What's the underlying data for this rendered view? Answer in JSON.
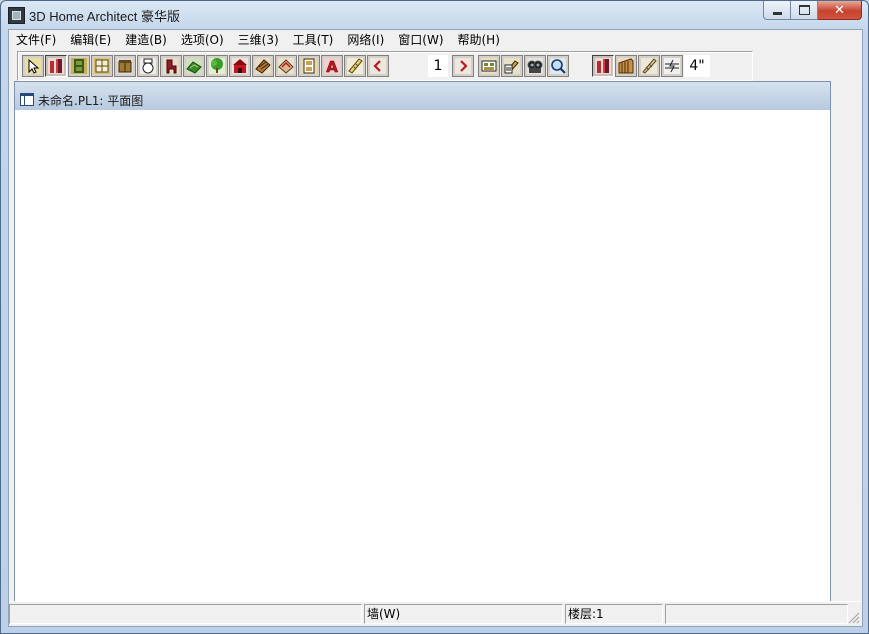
{
  "window": {
    "title": "3D Home Architect 豪华版"
  },
  "menu": [
    {
      "label": "文件(F)"
    },
    {
      "label": "编辑(E)"
    },
    {
      "label": "建造(B)"
    },
    {
      "label": "选项(O)"
    },
    {
      "label": "三维(3)"
    },
    {
      "label": "工具(T)"
    },
    {
      "label": "网络(I)"
    },
    {
      "label": "窗口(W)"
    },
    {
      "label": "帮助(H)"
    }
  ],
  "toolbar": {
    "floor_value": "1",
    "wall_thickness": "4\""
  },
  "document": {
    "title": "未命名.PL1: 平面图"
  },
  "status": {
    "mode": "墙(W)",
    "floor": "楼层:1"
  }
}
